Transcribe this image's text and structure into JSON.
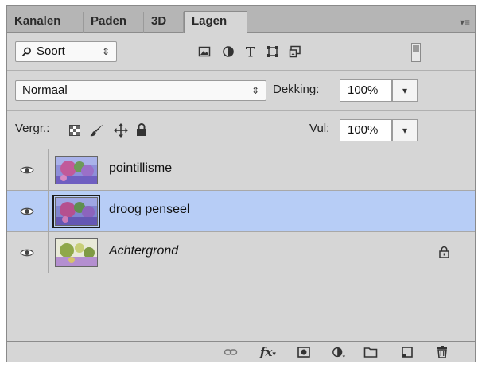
{
  "tabs": [
    {
      "label": "Kanalen"
    },
    {
      "label": "Paden"
    },
    {
      "label": "3D"
    },
    {
      "label": "Lagen",
      "active": true
    }
  ],
  "filter": {
    "kind_label": "Soort",
    "icons": [
      "image-filter-icon",
      "adjustment-filter-icon",
      "type-filter-icon",
      "shape-filter-icon",
      "smart-object-filter-icon"
    ]
  },
  "blend": {
    "mode": "Normaal",
    "opacity_label": "Dekking:",
    "opacity_value": "100%"
  },
  "lock": {
    "label": "Vergr.:",
    "fill_label": "Vul:",
    "fill_value": "100%"
  },
  "layers": [
    {
      "name": "pointillisme",
      "visible": true,
      "selected": false,
      "locked": false,
      "italic": false
    },
    {
      "name": "droog penseel",
      "visible": true,
      "selected": true,
      "locked": false,
      "italic": false
    },
    {
      "name": "Achtergrond",
      "visible": true,
      "selected": false,
      "locked": true,
      "italic": true
    }
  ],
  "bottom_bar": {
    "fx_label": "fx",
    "icons": [
      "link-icon",
      "fx-icon",
      "mask-icon",
      "adjustment-icon",
      "folder-icon",
      "new-layer-icon",
      "trash-icon"
    ]
  },
  "colors": {
    "panel_bg": "#d6d6d6",
    "selected_row": "#b7cdf6"
  }
}
